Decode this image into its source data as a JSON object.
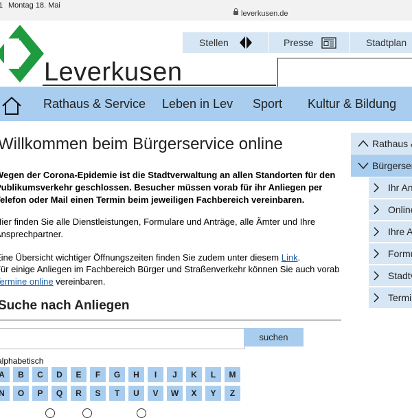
{
  "status_bar": {
    "time_fragment": "1",
    "date": "Montag 18. Mai",
    "url": "leverkusen.de"
  },
  "header": {
    "brand": "Leverkusen",
    "top_links": [
      {
        "label": "Stellen",
        "icon": "diamond-arrows-icon"
      },
      {
        "label": "Presse",
        "icon": "newspaper-icon"
      },
      {
        "label": "Stadtplan",
        "icon": ""
      }
    ],
    "search_value": ""
  },
  "main_nav": {
    "home_icon": "home-icon",
    "items": [
      "Rathaus & Service",
      "Leben in Lev",
      "Sport",
      "Kultur & Bildung"
    ]
  },
  "main": {
    "title": "Willkommen beim Bürgerservice online",
    "notice": "Wegen der Corona-Epidemie ist die Stadtverwaltung an allen Standorten für den Publikumsverkehr geschlossen. Besucher müssen vorab für ihr Anliegen per Telefon oder Mail einen Termin beim jeweiligen Fachbereich vereinbaren.",
    "intro": "Hier finden Sie alle Dienstleistungen, Formulare und Anträge, alle Ämter und Ihre Ansprechpartner.",
    "hours_text": "Eine Übersicht wichtiger Öffnungszeiten finden Sie zudem unter diesem ",
    "hours_link": "Link",
    "hours_end": ".",
    "appointment_text": "Für einige Anliegen im Fachbereich Bürger und Straßenverkehr können Sie auch vorab ",
    "appointment_link": "Termine online",
    "appointment_end": " vereinbaren.",
    "search_heading": "Suche nach Anliegen",
    "search_value": "",
    "search_button": "suchen",
    "alphabet_label": "alphabetisch",
    "letters_row1": [
      "A",
      "B",
      "C",
      "D",
      "E",
      "F",
      "G",
      "H",
      "I",
      "J",
      "K",
      "L",
      "M"
    ],
    "letters_row2": [
      "N",
      "O",
      "P",
      "Q",
      "R",
      "S",
      "T",
      "U",
      "V",
      "W",
      "X",
      "Y",
      "Z"
    ]
  },
  "sidebar": {
    "items": [
      {
        "label": "Rathaus & Service",
        "active": false,
        "icon": "chevron-up-icon"
      },
      {
        "label": "Bürgerservice online",
        "active": true,
        "icon": "chevron-down-icon"
      }
    ],
    "sub_items": [
      "Ihr Anliegen",
      "Online-Dienste",
      "Ihre Ansprechpartner",
      "Formulare",
      "Stadtverwaltung",
      "Termine"
    ]
  },
  "colors": {
    "nav_blue": "#a9cdee",
    "light_blue": "#d6e6f4",
    "logo_green": "#1f9a3f"
  }
}
